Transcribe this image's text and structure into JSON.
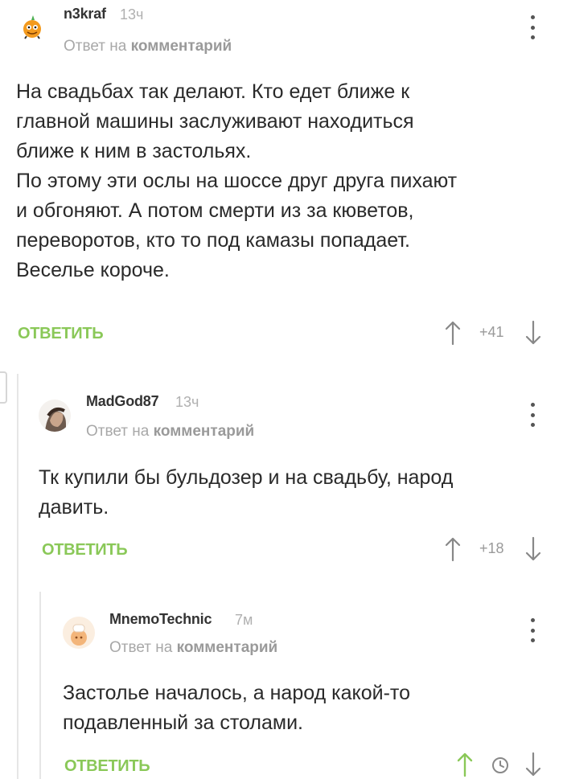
{
  "comments": [
    {
      "author": "n3kraf",
      "time": "13ч",
      "reply_prefix": "Ответ на",
      "reply_target": "комментарий",
      "body": [
        "На свадьбах так делают. Кто едет ближе к",
        "главной машины заслуживают находиться",
        "ближе к ним в застольях.",
        "По этому эти ослы на шоссе друг друга пихают",
        "и обгоняют. А потом смерти из за кюветов,",
        "переворотов, кто то под камазы попадает.",
        "Веселье короче."
      ],
      "reply_label": "ОТВЕТИТЬ",
      "rating": "+41"
    },
    {
      "author": "MadGod87",
      "time": "13ч",
      "reply_prefix": "Ответ на",
      "reply_target": "комментарий",
      "body": [
        "Тк купили бы бульдозер и на свадьбу, народ",
        "давить."
      ],
      "reply_label": "ОТВЕТИТЬ",
      "rating": "+18"
    },
    {
      "author": "MnemoTechnic",
      "time": "7м",
      "reply_prefix": "Ответ на",
      "reply_target": "комментарий",
      "body": [
        "Застолье началось, а народ какой-то",
        "подавленный за столами."
      ],
      "reply_label": "ОТВЕТИТЬ",
      "rating_icon": "clock-icon"
    }
  ],
  "colors": {
    "accent": "#8ac858",
    "muted": "#a8a8a8",
    "text": "#2a2a2a"
  }
}
